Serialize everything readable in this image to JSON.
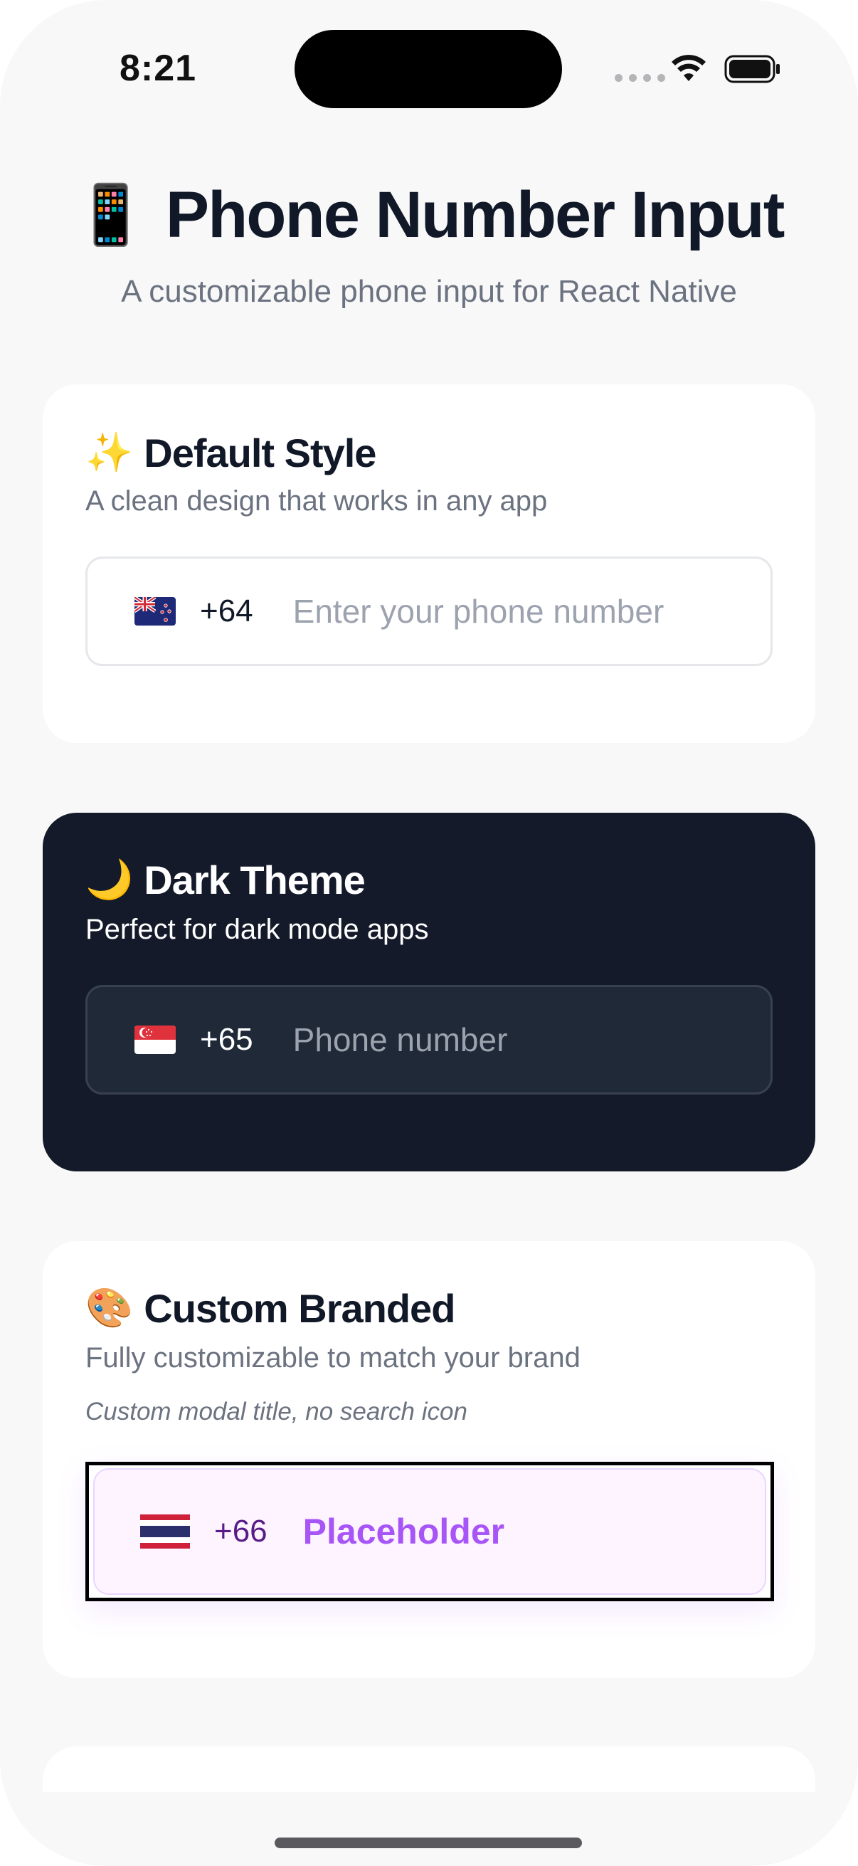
{
  "status_bar": {
    "time": "8:21"
  },
  "header": {
    "title_emoji": "📱",
    "title": "Phone Number Input",
    "subtitle": "A customizable phone input for React Native"
  },
  "cards": [
    {
      "emoji": "✨",
      "title": "Default Style",
      "description": "A clean design that works in any app",
      "input": {
        "flag": "new-zealand-flag",
        "country_code": "+64",
        "placeholder": "Enter your phone number"
      }
    },
    {
      "emoji": "🌙",
      "title": "Dark Theme",
      "description": "Perfect for dark mode apps",
      "input": {
        "flag": "singapore-flag",
        "country_code": "+65",
        "placeholder": "Phone number"
      }
    },
    {
      "emoji": "🎨",
      "title": "Custom Branded",
      "description": "Fully customizable to match your brand",
      "note": "Custom modal title, no search icon",
      "input": {
        "flag": "thailand-flag",
        "country_code": "+66",
        "placeholder": "Placeholder"
      }
    }
  ],
  "colors": {
    "background": "#f8f8f9",
    "card_light": "#ffffff",
    "card_dark": "#141a2a",
    "brand_purple": "#a855f7",
    "brand_code": "#581c87",
    "title_text": "#111827",
    "muted_text": "#6b7280"
  }
}
